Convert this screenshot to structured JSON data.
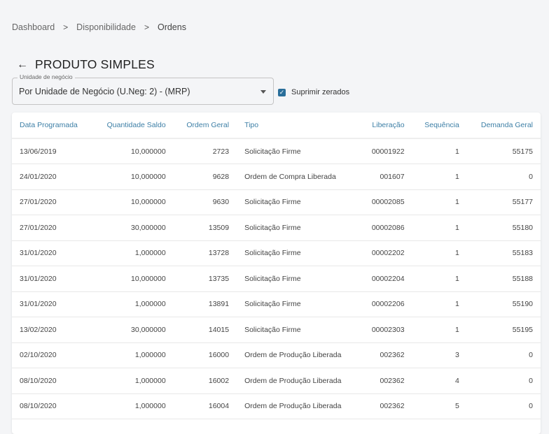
{
  "breadcrumb": [
    "Dashboard",
    "Disponibilidade",
    "Ordens"
  ],
  "title": "PRODUTO SIMPLES",
  "unit_field": {
    "label": "Unidade de negócio",
    "value": "Por Unidade de Negócio (U.Neg: 2) - (MRP)"
  },
  "suppress": {
    "label": "Suprimir zerados",
    "checked": true
  },
  "table": {
    "columns": [
      "Data Programada",
      "Quantidade Saldo",
      "Ordem Geral",
      "Tipo",
      "Liberação",
      "Sequência",
      "Demanda Geral"
    ],
    "rows": [
      [
        "13/06/2019",
        "10,000000",
        "2723",
        "Solicitação Firme",
        "00001922",
        "1",
        "55175"
      ],
      [
        "24/01/2020",
        "10,000000",
        "9628",
        "Ordem de Compra Liberada",
        "001607",
        "1",
        "0"
      ],
      [
        "27/01/2020",
        "10,000000",
        "9630",
        "Solicitação Firme",
        "00002085",
        "1",
        "55177"
      ],
      [
        "27/01/2020",
        "30,000000",
        "13509",
        "Solicitação Firme",
        "00002086",
        "1",
        "55180"
      ],
      [
        "31/01/2020",
        "1,000000",
        "13728",
        "Solicitação Firme",
        "00002202",
        "1",
        "55183"
      ],
      [
        "31/01/2020",
        "10,000000",
        "13735",
        "Solicitação Firme",
        "00002204",
        "1",
        "55188"
      ],
      [
        "31/01/2020",
        "1,000000",
        "13891",
        "Solicitação Firme",
        "00002206",
        "1",
        "55190"
      ],
      [
        "13/02/2020",
        "30,000000",
        "14015",
        "Solicitação Firme",
        "00002303",
        "1",
        "55195"
      ],
      [
        "02/10/2020",
        "1,000000",
        "16000",
        "Ordem de Produção Liberada",
        "002362",
        "3",
        "0"
      ],
      [
        "08/10/2020",
        "1,000000",
        "16002",
        "Ordem de Produção Liberada",
        "002362",
        "4",
        "0"
      ],
      [
        "08/10/2020",
        "1,000000",
        "16004",
        "Ordem de Produção Liberada",
        "002362",
        "5",
        "0"
      ]
    ]
  }
}
